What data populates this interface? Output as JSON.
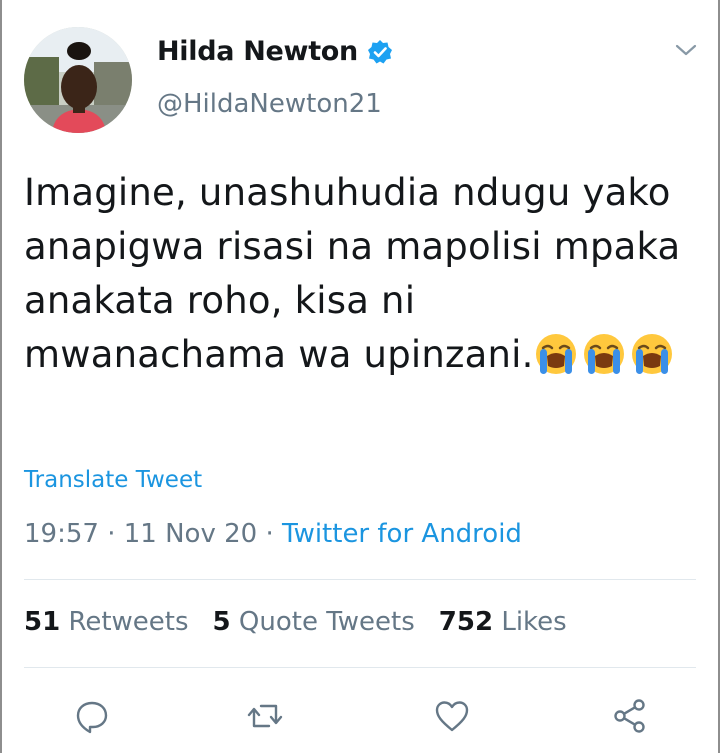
{
  "author": {
    "display_name": "Hilda Newton",
    "handle": "@HildaNewton21",
    "verified": true
  },
  "tweet": {
    "text": "Imagine, unashuhudia ndugu yako anapigwa risasi na mapolisi mpaka anakata roho, kisa ni mwanachama wa upinzani.",
    "emojis": [
      "loudly-crying-face",
      "loudly-crying-face",
      "loudly-crying-face"
    ]
  },
  "translate_label": "Translate Tweet",
  "meta": {
    "time": "19:57",
    "separator": " · ",
    "date": "11 Nov 20",
    "source": "Twitter for Android"
  },
  "stats": [
    {
      "count": "51",
      "label": "Retweets"
    },
    {
      "count": "5",
      "label": "Quote Tweets"
    },
    {
      "count": "752",
      "label": "Likes"
    }
  ],
  "actions": [
    "reply-icon",
    "retweet-icon",
    "like-icon",
    "share-icon"
  ],
  "colors": {
    "link": "#1b95e0",
    "secondary_text": "#657786",
    "primary_text": "#14171a",
    "verified_badge": "#1da1f2",
    "divider": "#e1e8ed"
  }
}
